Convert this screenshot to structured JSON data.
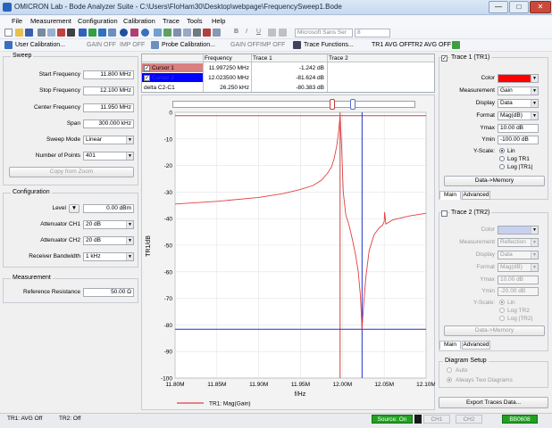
{
  "window": {
    "title": "OMICRON Lab - Bode Analyzer Suite - C:\\Users\\FloHam30\\Desktop\\webpage\\FrequencySweep1.Bode",
    "min": "—",
    "max": "□",
    "close": "✕"
  },
  "menu": [
    "File",
    "Measurement",
    "Configuration",
    "Calibration",
    "Trace",
    "Tools",
    "Help"
  ],
  "toolbar": {
    "font_name": "Microsoft Sans Ser",
    "font_size": "8",
    "bold": "B",
    "italic": "I",
    "underline": "U",
    "user_calibration": "User Calibration...",
    "gain_off_1": "GAIN OFF",
    "imp_off_1": "IMP OFF",
    "probe_calibration": "Probe Calibration...",
    "gain_off_2": "GAIN OFF",
    "imp_off_2": "IMP OFF",
    "trace_functions": "Trace Functions...",
    "tr1_avg": "TR1 AVG OFF",
    "tr2_avg": "TR2 AVG OFF"
  },
  "sweep": {
    "title": "Sweep",
    "start_label": "Start Frequency",
    "start_value": "11.800 MHz",
    "stop_label": "Stop Frequency",
    "stop_value": "12.100 MHz",
    "center_label": "Center Frequency",
    "center_value": "11.950 MHz",
    "span_label": "Span",
    "span_value": "300.000 kHz",
    "mode_label": "Sweep Mode",
    "mode_value": "Linear",
    "points_label": "Number of Points",
    "points_value": "401",
    "copy_zoom": "Copy from Zoom"
  },
  "configuration": {
    "title": "Configuration",
    "level_label": "Level",
    "level_value": "0.00 dBm",
    "att1_label": "Attenuator CH1",
    "att1_value": "20 dB",
    "att2_label": "Attenuator CH2",
    "att2_value": "20 dB",
    "rbw_label": "Receiver Bandwidth",
    "rbw_value": "1 kHz"
  },
  "measurement": {
    "title": "Measurement",
    "ref_label": "Reference Resistance",
    "ref_value": "50.00 Ω"
  },
  "cursor_table": {
    "headers": [
      "",
      "Frequency",
      "Trace 1",
      "Trace 2"
    ],
    "rows": [
      {
        "name": "Cursor 1",
        "freq": "11.997250 MHz",
        "trace1": "-1.242 dB",
        "trace2": "",
        "color": "#d98080"
      },
      {
        "name": "Cursor 2",
        "freq": "12.023500 MHz",
        "trace1": "-81.624 dB",
        "trace2": "",
        "color": "#0000ff"
      },
      {
        "name": "delta C2-C1",
        "freq": "26.250 kHz",
        "trace1": "-80.383 dB",
        "trace2": "",
        "color": "#ffffff"
      }
    ]
  },
  "chart_data": {
    "type": "line",
    "xlabel": "f/Hz",
    "ylabel": "TR1/dB",
    "xlim": [
      11800000,
      12100000
    ],
    "ylim": [
      -100,
      0
    ],
    "x_ticks": [
      "11.80M",
      "11.85M",
      "11.90M",
      "11.95M",
      "12.00M",
      "12.05M",
      "12.10M"
    ],
    "y_ticks": [
      "0",
      "-10",
      "-20",
      "-30",
      "-40",
      "-50",
      "-60",
      "-70",
      "-80",
      "-90",
      "-100"
    ],
    "grid": true,
    "legend": "bottom",
    "series": [
      {
        "name": "TR1: Mag(Gain)",
        "color": "#e04040",
        "x": [
          11800000,
          11850000,
          11900000,
          11930000,
          11950000,
          11965000,
          11975000,
          11982000,
          11987000,
          11990000,
          11993000,
          11995000,
          11997250,
          11999000,
          12001000,
          12004000,
          12008000,
          12012000,
          12016000,
          12019000,
          12021500,
          12023500,
          12025500,
          12028000,
          12032000,
          12038000,
          12044000,
          12048000,
          12050000,
          12050500,
          12052000,
          12060000,
          12080000,
          12100000
        ],
        "y": [
          -34.5,
          -33.5,
          -32.0,
          -30.5,
          -29.0,
          -27.5,
          -25.5,
          -23.0,
          -20.5,
          -17.5,
          -13.0,
          -8.5,
          -1.2,
          -12.0,
          -30.0,
          -38.5,
          -42.5,
          -48.0,
          -54.0,
          -60.0,
          -69.0,
          -81.6,
          -72.0,
          -62.0,
          -52.0,
          -46.0,
          -43.5,
          -42.5,
          -41.0,
          -37.5,
          -42.0,
          -40.5,
          -39.0,
          -38.0
        ]
      }
    ],
    "cursors": [
      {
        "name": "Cursor 1",
        "x": 11997250,
        "y": -1.242,
        "color": "#d04040"
      },
      {
        "name": "Cursor 2",
        "x": 12023500,
        "y": -81.624,
        "color": "#2030d0"
      }
    ]
  },
  "trace1": {
    "title": "Trace 1 (TR1)",
    "color_label": "Color",
    "color_value": "#ff0000",
    "measurement_label": "Measurement",
    "measurement_value": "Gain",
    "display_label": "Display",
    "display_value": "Data",
    "format_label": "Format",
    "format_value": "Mag(dB)",
    "ymax_label": "Ymax",
    "ymax_value": "10.00 dB",
    "ymin_label": "Ymin",
    "ymin_value": "-100.00 dB",
    "yscale_label": "Y-Scale:",
    "scale_lin": "Lin",
    "scale_log_tr1": "Log TR1",
    "scale_log_tr1_bar": "Log |TR1|",
    "data_memory": "Data->Memory",
    "tab_main": "Main",
    "tab_advanced": "Advanced"
  },
  "trace2": {
    "title": "Trace 2 (TR2)",
    "color_label": "Color",
    "measurement_label": "Measurement",
    "measurement_value": "Reflection",
    "display_label": "Display",
    "display_value": "Data",
    "format_label": "Format",
    "format_value": "Mag(dB)",
    "ymax_label": "Ymax",
    "ymax_value": "10.00 dB",
    "ymin_label": "Ymin",
    "ymin_value": "-20.00 dB",
    "yscale_label": "Y-Scale:",
    "scale_lin": "Lin",
    "scale_log_tr2": "Log TR2",
    "scale_log_tr2_bar": "Log |TR2|",
    "data_memory": "Data->Memory",
    "tab_main": "Main",
    "tab_advanced": "Advanced"
  },
  "diagram_setup": {
    "title": "Diagram Setup",
    "auto": "Auto",
    "always_two": "Always Two Diagrams"
  },
  "export_button": "Export Traces Data...",
  "status": {
    "tr1": "TR1:  AVG Off",
    "tr2": "TR2:  Off",
    "source": "Source: On",
    "ch1": "CH1",
    "ch2": "CH2",
    "device": "BB0608"
  }
}
